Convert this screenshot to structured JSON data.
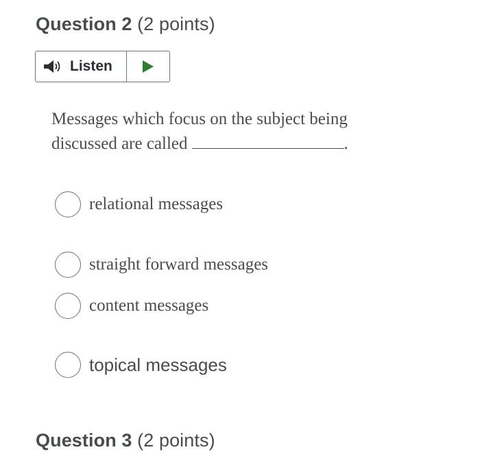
{
  "question2": {
    "title": "Question 2",
    "points": "(2 points)"
  },
  "listen": {
    "label": "Listen",
    "icon": "speaker-icon",
    "play_icon": "play-icon",
    "play_color": "#2e7d32"
  },
  "question": {
    "text": "Messages which focus on the subject being discussed are called",
    "blank_suffix": "."
  },
  "options": [
    {
      "label": "relational messages"
    },
    {
      "label": "straight forward messages"
    },
    {
      "label": "content messages"
    },
    {
      "label": "topical messages"
    }
  ],
  "question3": {
    "title": "Question 3",
    "points": "(2 points)"
  }
}
